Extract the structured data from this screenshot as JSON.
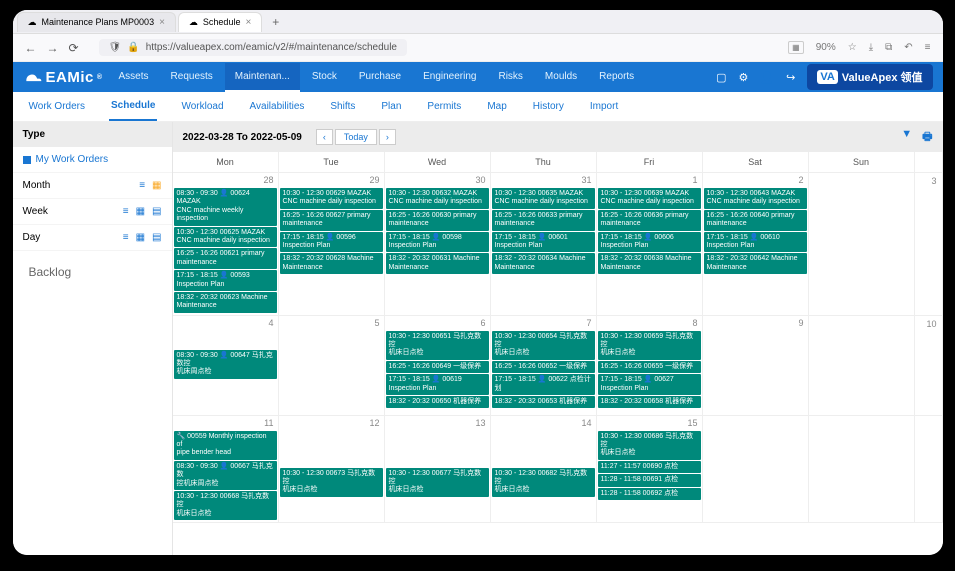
{
  "browser": {
    "tabs": [
      {
        "title": "Maintenance Plans MP0003"
      },
      {
        "title": "Schedule"
      }
    ],
    "url": "https://valueapex.com/eamic/v2/#/maintenance/schedule",
    "zoom": "90%"
  },
  "brand": {
    "eamic": "EAMic",
    "reg": "®",
    "va": "ValueApex 领值"
  },
  "modnav": [
    "Assets",
    "Requests",
    "Maintenan...",
    "Stock",
    "Purchase",
    "Engineering",
    "Risks",
    "Moulds",
    "Reports"
  ],
  "modnav_active": 2,
  "subnav": [
    "Work Orders",
    "Schedule",
    "Workload",
    "Availabilities",
    "Shifts",
    "Plan",
    "Permits",
    "Map",
    "History",
    "Import"
  ],
  "subnav_active": 1,
  "sidebar": {
    "header": "Type",
    "mywo": "My Work Orders",
    "rows": [
      {
        "label": "Month",
        "icons": [
          "list",
          "grid-y"
        ]
      },
      {
        "label": "Week",
        "icons": [
          "list",
          "grid",
          "cal"
        ]
      },
      {
        "label": "Day",
        "icons": [
          "list",
          "grid",
          "cal"
        ]
      }
    ],
    "backlog": "Backlog"
  },
  "cal": {
    "range": "2022-03-28 To 2022-05-09",
    "today": "Today",
    "days": [
      "Mon",
      "Tue",
      "Wed",
      "Thu",
      "Fri",
      "Sat",
      "Sun"
    ],
    "weeks": [
      {
        "gutter": "3",
        "cells": [
          {
            "d": "28",
            "ev": [
              {
                "t": "08:30 - 09:30 👤 00624 MAZAK",
                "s": "CNC machine weekly inspection"
              },
              {
                "t": "10:30 - 12:30 00625 MAZAK",
                "s": "CNC machine daily inspection"
              },
              {
                "t": "16:25 - 16:26 00621 primary",
                "s": "maintenance"
              },
              {
                "t": "17:15 - 18:15 👤 00593",
                "s": "Inspection Plan"
              },
              {
                "t": "18:32 - 20:32 00623 Machine",
                "s": "Maintenance"
              }
            ]
          },
          {
            "d": "29",
            "ev": [
              {
                "t": "10:30 - 12:30 00629 MAZAK",
                "s": "CNC machine daily inspection"
              },
              {
                "t": "16:25 - 16:26 00627 primary",
                "s": "maintenance"
              },
              {
                "t": "17:15 - 18:15 👤 00596",
                "s": "Inspection Plan"
              },
              {
                "t": "18:32 - 20:32 00628 Machine",
                "s": "Maintenance"
              }
            ]
          },
          {
            "d": "30",
            "ev": [
              {
                "t": "10:30 - 12:30 00632 MAZAK",
                "s": "CNC machine daily inspection"
              },
              {
                "t": "16:25 - 16:26 00630 primary",
                "s": "maintenance"
              },
              {
                "t": "17:15 - 18:15 👤 00598",
                "s": "Inspection Plan"
              },
              {
                "t": "18:32 - 20:32 00631 Machine",
                "s": "Maintenance"
              }
            ]
          },
          {
            "d": "31",
            "ev": [
              {
                "t": "10:30 - 12:30 00635 MAZAK",
                "s": "CNC machine daily inspection"
              },
              {
                "t": "16:25 - 16:26 00633 primary",
                "s": "maintenance"
              },
              {
                "t": "17:15 - 18:15 👤 00601",
                "s": "Inspection Plan"
              },
              {
                "t": "18:32 - 20:32 00634 Machine",
                "s": "Maintenance"
              }
            ]
          },
          {
            "d": "1",
            "ev": [
              {
                "t": "10:30 - 12:30 00639 MAZAK",
                "s": "CNC machine daily inspection"
              },
              {
                "t": "16:25 - 16:26 00636 primary",
                "s": "maintenance"
              },
              {
                "t": "17:15 - 18:15 👤 00606",
                "s": "Inspection Plan"
              },
              {
                "t": "18:32 - 20:32 00638 Machine",
                "s": "Maintenance"
              }
            ]
          },
          {
            "d": "2",
            "ev": [
              {
                "t": "10:30 - 12:30 00643 MAZAK",
                "s": "CNC machine daily inspection"
              },
              {
                "t": "16:25 - 16:26 00640 primary",
                "s": "maintenance"
              },
              {
                "t": "17:15 - 18:15 👤 00610",
                "s": "Inspection Plan"
              },
              {
                "t": "18:32 - 20:32 00642 Machine",
                "s": "Maintenance"
              }
            ]
          },
          {
            "d": "",
            "ev": []
          }
        ]
      },
      {
        "gutter": "10",
        "cells": [
          {
            "d": "4",
            "ev": [
              {
                "t": "08:30 - 09:30 👤 00647 马扎克数控",
                "s": "机床周点检"
              }
            ],
            "pad": 1
          },
          {
            "d": "5",
            "ev": []
          },
          {
            "d": "6",
            "ev": [
              {
                "t": "10:30 - 12:30 00651 马扎克数控",
                "s": "机床日点检"
              },
              {
                "t": "16:25 - 16:26 00649 一级保养",
                "s": ""
              },
              {
                "t": "17:15 - 18:15 👤 00619",
                "s": "Inspection Plan"
              },
              {
                "t": "18:32 - 20:32 00650 机器保养",
                "s": ""
              }
            ]
          },
          {
            "d": "7",
            "ev": [
              {
                "t": "10:30 - 12:30 00654 马扎克数控",
                "s": "机床日点检"
              },
              {
                "t": "16:25 - 16:26 00652 一级保养",
                "s": ""
              },
              {
                "t": "17:15 - 18:15 👤 00622 点检计划",
                "s": ""
              },
              {
                "t": "18:32 - 20:32 00653 机器保养",
                "s": ""
              }
            ]
          },
          {
            "d": "8",
            "ev": [
              {
                "t": "10:30 - 12:30 00659 马扎克数控",
                "s": "机床日点检"
              },
              {
                "t": "16:25 - 16:26 00655 一级保养",
                "s": ""
              },
              {
                "t": "17:15 - 18:15 👤 00627",
                "s": "Inspection Plan"
              },
              {
                "t": "18:32 - 20:32 00658 机器保养",
                "s": ""
              }
            ]
          },
          {
            "d": "9",
            "ev": []
          },
          {
            "d": "",
            "ev": []
          }
        ]
      },
      {
        "gutter": "",
        "cells": [
          {
            "d": "11",
            "ev": [
              {
                "t": "🔧 00559 Monthly inspection of",
                "s": "pipe bender head"
              },
              {
                "t": "08:30 - 09:30 👤 00667 马扎克数",
                "s": "控机床周点检"
              },
              {
                "t": "10:30 - 12:30 00668 马扎克数控",
                "s": "机床日点检"
              }
            ]
          },
          {
            "d": "12",
            "ev": [
              {
                "t": "10:30 - 12:30 00673 马扎克数控",
                "s": "机床日点检"
              }
            ],
            "pad": 2
          },
          {
            "d": "13",
            "ev": [
              {
                "t": "10:30 - 12:30 00677 马扎克数控",
                "s": "机床日点检"
              }
            ],
            "pad": 2
          },
          {
            "d": "14",
            "ev": [
              {
                "t": "10:30 - 12:30 00682 马扎克数控",
                "s": "机床日点检"
              }
            ],
            "pad": 2
          },
          {
            "d": "15",
            "ev": [
              {
                "t": "10:30 - 12:30 00686 马扎克数控",
                "s": "机床日点检"
              },
              {
                "t": "11:27 - 11:57 00690 点检",
                "s": ""
              },
              {
                "t": "11:28 - 11:58 00691 点检",
                "s": ""
              },
              {
                "t": "11:28 - 11:58 00692 点检",
                "s": ""
              }
            ]
          },
          {
            "d": "",
            "ev": []
          },
          {
            "d": "",
            "ev": []
          }
        ]
      }
    ]
  }
}
